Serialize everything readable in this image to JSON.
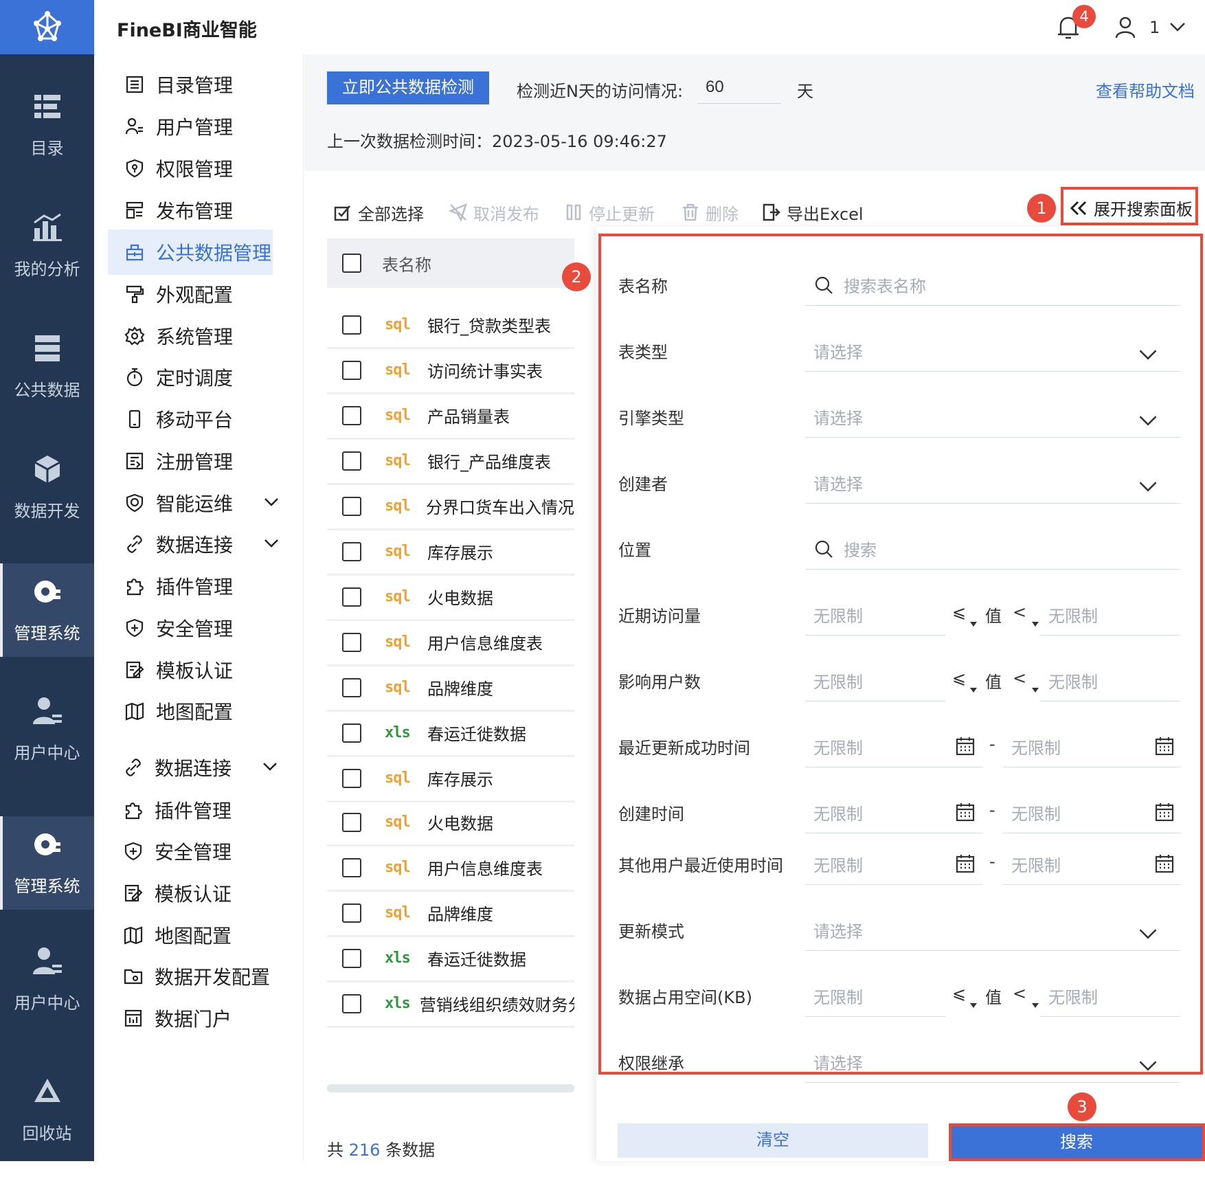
{
  "app": {
    "title": "FineBI商业智能",
    "notification_count": "4",
    "user_name": "1"
  },
  "nav_rail": [
    {
      "id": "catalog",
      "label": "目录"
    },
    {
      "id": "analysis",
      "label": "我的分析"
    },
    {
      "id": "public-data",
      "label": "公共数据"
    },
    {
      "id": "data-dev",
      "label": "数据开发"
    },
    {
      "id": "admin",
      "label": "管理系统",
      "active": true
    },
    {
      "id": "user-center",
      "label": "用户中心"
    },
    {
      "id": "admin-2",
      "label": "管理系统",
      "active": true
    },
    {
      "id": "user-center-2",
      "label": "用户中心"
    },
    {
      "id": "recycle",
      "label": "回收站"
    }
  ],
  "menu": [
    {
      "label": "目录管理",
      "icon": "list-icon"
    },
    {
      "label": "用户管理",
      "icon": "user-list-icon"
    },
    {
      "label": "权限管理",
      "icon": "shield-key-icon"
    },
    {
      "label": "发布管理",
      "icon": "publish-icon"
    },
    {
      "label": "公共数据管理",
      "icon": "public-data-icon",
      "active": true
    },
    {
      "label": "外观配置",
      "icon": "paint-roller-icon"
    },
    {
      "label": "系统管理",
      "icon": "gear-icon"
    },
    {
      "label": "定时调度",
      "icon": "stopwatch-icon"
    },
    {
      "label": "移动平台",
      "icon": "mobile-icon"
    },
    {
      "label": "注册管理",
      "icon": "register-icon"
    },
    {
      "label": "智能运维",
      "icon": "ops-icon",
      "expandable": true
    },
    {
      "label": "数据连接",
      "icon": "link-icon",
      "expandable": true
    },
    {
      "label": "插件管理",
      "icon": "puzzle-icon"
    },
    {
      "label": "安全管理",
      "icon": "shield-plus-icon"
    },
    {
      "label": "模板认证",
      "icon": "template-cert-icon"
    },
    {
      "label": "地图配置",
      "icon": "map-icon"
    },
    {
      "label": "数据连接",
      "icon": "link-icon",
      "expandable": true
    },
    {
      "label": "插件管理",
      "icon": "puzzle-icon"
    },
    {
      "label": "安全管理",
      "icon": "shield-plus-icon"
    },
    {
      "label": "模板认证",
      "icon": "template-cert-icon"
    },
    {
      "label": "地图配置",
      "icon": "map-icon"
    },
    {
      "label": "数据开发配置",
      "icon": "folder-gear-icon"
    },
    {
      "label": "数据门户",
      "icon": "portal-icon"
    }
  ],
  "detect": {
    "button": "立即公共数据检测",
    "days_label": "检测近N天的访问情况:",
    "days_value": "60",
    "days_unit": "天",
    "help_link": "查看帮助文档",
    "last_time": "上一次数据检测时间：2023-05-16 09:46:27"
  },
  "toolbar": {
    "select_all": "全部选择",
    "unpublish": "取消发布",
    "stop_update": "停止更新",
    "delete": "删除",
    "export": "导出Excel",
    "expand_search": "展开搜索面板"
  },
  "table": {
    "header": "表名称",
    "rows": [
      {
        "type": "sql",
        "name": "银行_贷款类型表"
      },
      {
        "type": "sql",
        "name": "访问统计事实表"
      },
      {
        "type": "sql",
        "name": "产品销量表"
      },
      {
        "type": "sql",
        "name": "银行_产品维度表"
      },
      {
        "type": "sql",
        "name": "分界口货车出入情况"
      },
      {
        "type": "sql",
        "name": "库存展示"
      },
      {
        "type": "sql",
        "name": "火电数据"
      },
      {
        "type": "sql",
        "name": "用户信息维度表"
      },
      {
        "type": "sql",
        "name": "品牌维度"
      },
      {
        "type": "xls",
        "name": "春运迁徙数据"
      },
      {
        "type": "sql",
        "name": "库存展示"
      },
      {
        "type": "sql",
        "name": "火电数据"
      },
      {
        "type": "sql",
        "name": "用户信息维度表"
      },
      {
        "type": "sql",
        "name": "品牌维度"
      },
      {
        "type": "xls",
        "name": "春运迁徙数据"
      },
      {
        "type": "xls",
        "name": "营销线组织绩效财务分析"
      }
    ],
    "total_prefix": "共",
    "total_count": "216",
    "total_suffix": "条数据"
  },
  "filter_panel": {
    "name": {
      "label": "表名称",
      "placeholder": "搜索表名称"
    },
    "table_type": {
      "label": "表类型",
      "placeholder": "请选择"
    },
    "engine_type": {
      "label": "引擎类型",
      "placeholder": "请选择"
    },
    "creator": {
      "label": "创建者",
      "placeholder": "请选择"
    },
    "location": {
      "label": "位置",
      "placeholder": "搜索"
    },
    "recent_visits": {
      "label": "近期访问量",
      "min": "无限制",
      "op1": "⩽",
      "value": "值",
      "op2": "<",
      "max": "无限制"
    },
    "affected_users": {
      "label": "影响用户数",
      "min": "无限制",
      "op1": "⩽",
      "value": "值",
      "op2": "<",
      "max": "无限制"
    },
    "last_success": {
      "label": "最近更新成功时间",
      "start": "无限制",
      "sep": "-",
      "end": "无限制"
    },
    "created_time": {
      "label": "创建时间",
      "start": "无限制",
      "sep": "-",
      "end": "无限制"
    },
    "others_used": {
      "label": "其他用户最近使用时间",
      "start": "无限制",
      "sep": "-",
      "end": "无限制"
    },
    "update_mode": {
      "label": "更新模式",
      "placeholder": "请选择"
    },
    "space": {
      "label": "数据占用空间(KB)",
      "min": "无限制",
      "op1": "⩽",
      "value": "值",
      "op2": "<",
      "max": "无限制"
    },
    "inherit": {
      "label": "权限继承",
      "placeholder": "请选择"
    },
    "clear_button": "清空",
    "search_button": "搜索"
  },
  "annotations": [
    "1",
    "2",
    "3"
  ],
  "colors": {
    "brand": "#3b72d8",
    "nav": "#243752",
    "highlight": "#e84a3c",
    "sql": "#f2a12e",
    "xls": "#2f9a3b"
  }
}
